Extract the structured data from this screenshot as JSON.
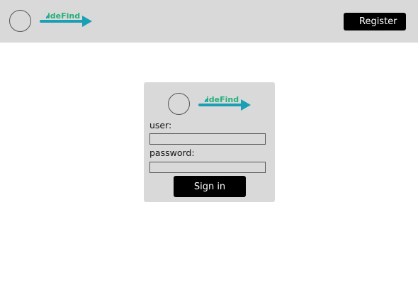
{
  "brand": {
    "logo_text": "ideFind",
    "accent_color": "#1a9fb5",
    "text_color": "#21b07a"
  },
  "header": {
    "register_label": "Register"
  },
  "login": {
    "user_label": "user:",
    "user_value": "",
    "password_label": "password:",
    "password_value": "",
    "signin_label": "Sign in"
  }
}
